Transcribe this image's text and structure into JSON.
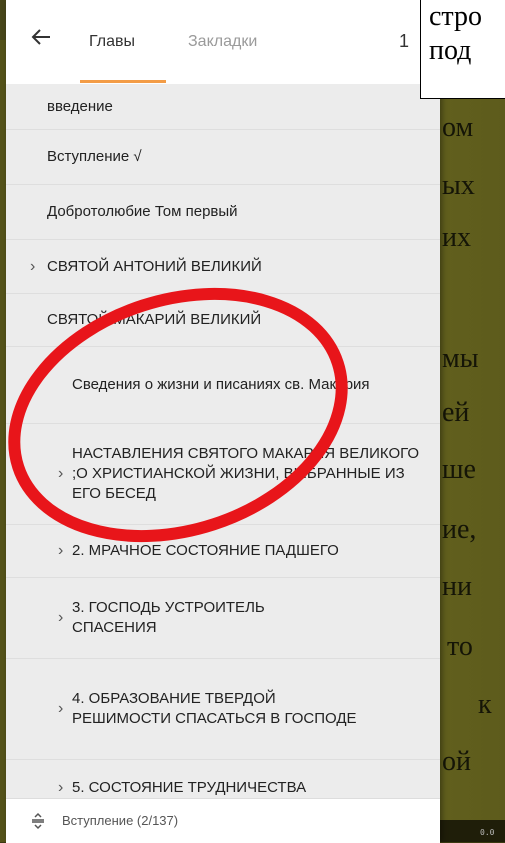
{
  "background": {
    "words": [
      "ом",
      "ых",
      "их",
      "мы",
      "ей",
      "ше",
      "ие,",
      "ни",
      "то",
      "к",
      "ой"
    ],
    "bottom_text": "0.0"
  },
  "overlay": {
    "lines": [
      "стро",
      "под"
    ]
  },
  "header": {
    "tabs": [
      {
        "label": "Главы",
        "active": true
      },
      {
        "label": "Закладки",
        "active": false
      }
    ],
    "count": "1"
  },
  "toc": [
    {
      "label": "введение",
      "expandable": false,
      "level": 0
    },
    {
      "label": "Вступление √",
      "expandable": false,
      "level": 0
    },
    {
      "label": "Добротолюбие Том первый",
      "expandable": false,
      "level": 0
    },
    {
      "label": "СВЯТОЙ АНТОНИЙ ВЕЛИКИЙ",
      "expandable": true,
      "level": 0
    },
    {
      "label": "СВЯТОЙ МАКАРИЙ ВЕЛИКИЙ",
      "expandable": false,
      "level": 0
    },
    {
      "label": "Сведения о жизни и писаниях св. Макария",
      "expandable": false,
      "level": 1
    },
    {
      "label": "НАСТАВЛЕНИЯ СВЯТОГО МАКАРИЯ ВЕЛИКОГО ;О ХРИСТИАНСКОЙ ЖИЗНИ, ВЫБРАННЫЕ ИЗ ЕГО БЕСЕД",
      "expandable": true,
      "level": 1
    },
    {
      "label": "2. МРАЧНОЕ СОСТОЯНИЕ ПАДШЕГО",
      "expandable": true,
      "level": 1
    },
    {
      "label": "3. ГОСПОДЬ УСТРОИТЕЛЬ СПАСЕНИЯ",
      "expandable": true,
      "level": 1
    },
    {
      "label": "4. ОБРАЗОВАНИЕ ТВЕРДОЙ РЕШИМОСТИ СПАСАТЬСЯ В ГОСПОДЕ",
      "expandable": true,
      "level": 1
    },
    {
      "label": "5. СОСТОЯНИЕ ТРУДНИЧЕСТВА",
      "expandable": true,
      "level": 1
    }
  ],
  "footer": {
    "position": "Вступление (2/137)"
  },
  "colors": {
    "accent": "#f39c46",
    "annotation": "#e8151a"
  },
  "icons": {
    "back": "arrow-left-icon",
    "sort": "sort-icon",
    "chevron": "chevron-right-icon"
  }
}
